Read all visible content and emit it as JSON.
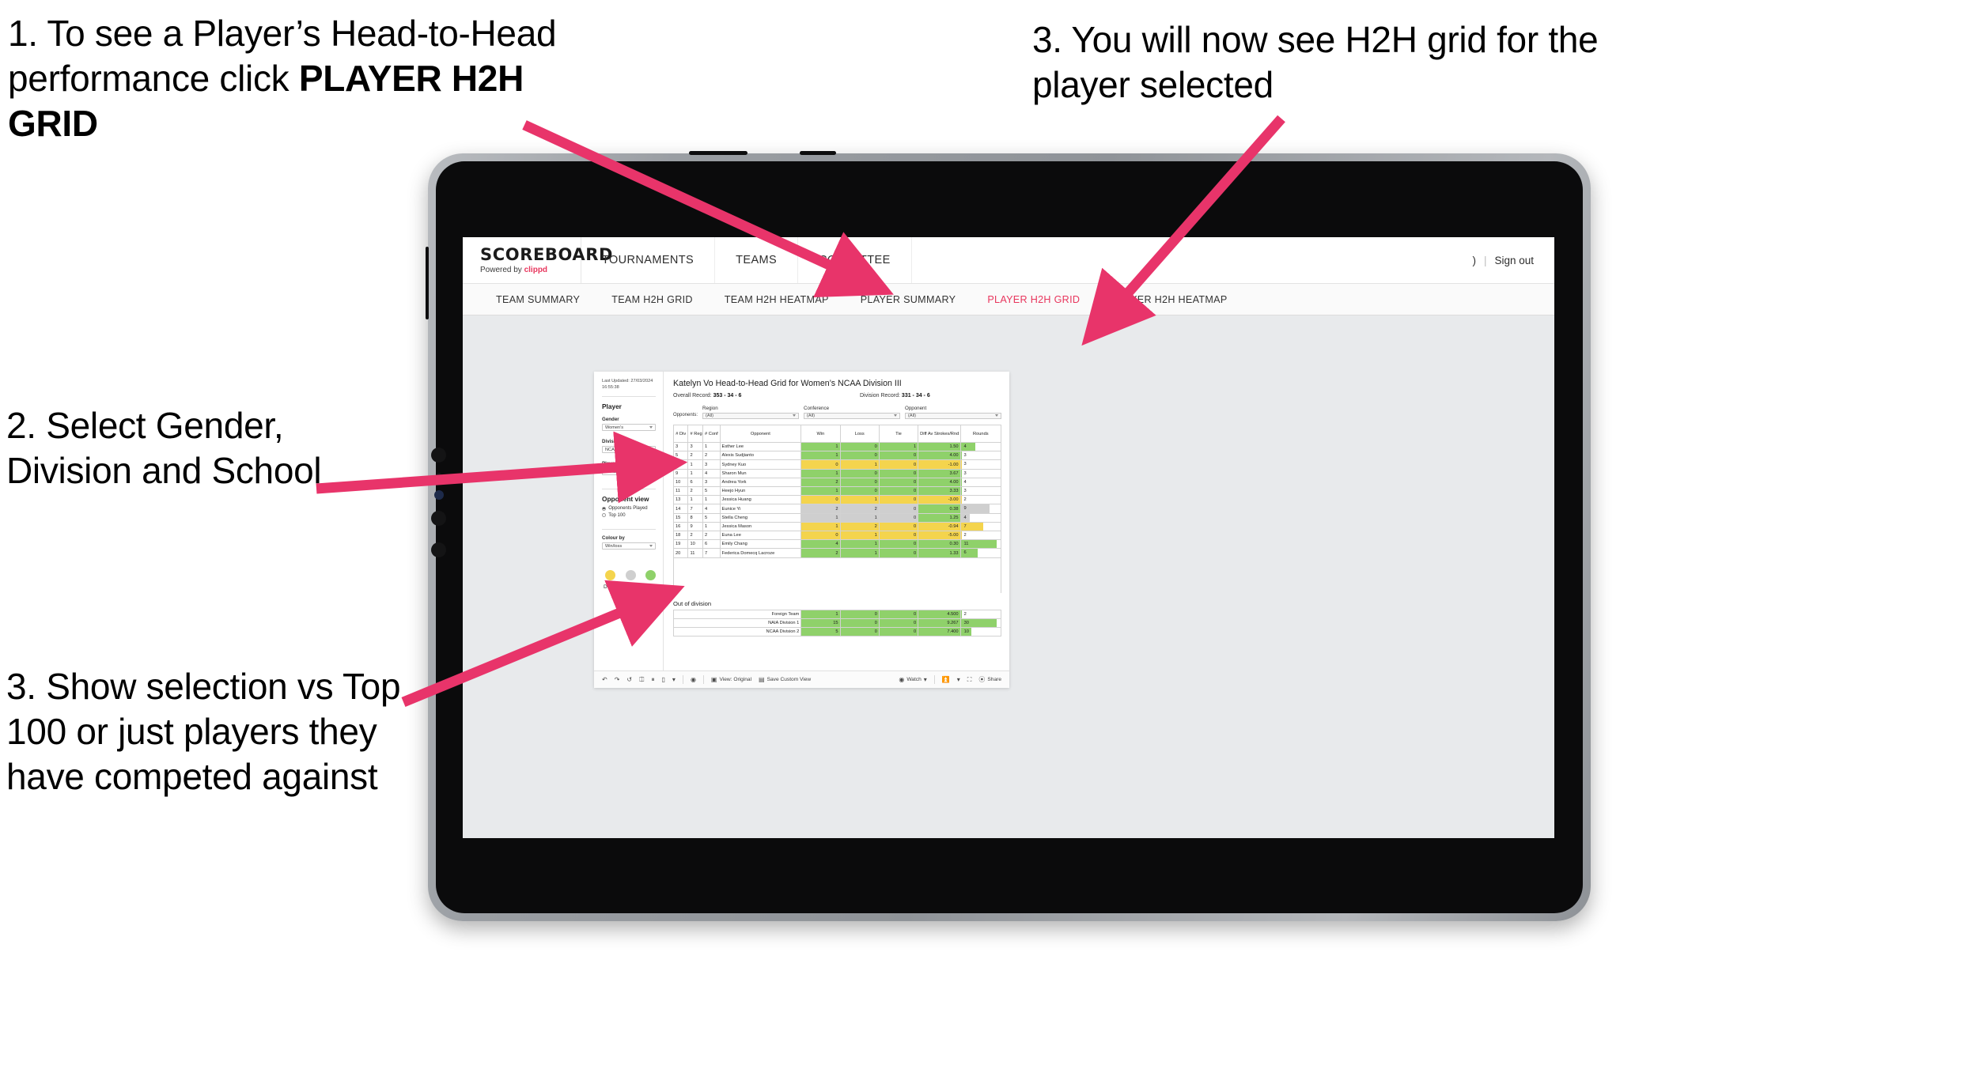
{
  "annotations": [
    {
      "id": "a1",
      "text_plain": "1. To see a Player’s Head-to-Head performance click ",
      "text_bold": "PLAYER H2H GRID"
    },
    {
      "id": "a2",
      "text": "2. Select Gender, Division and School"
    },
    {
      "id": "a3",
      "text": "3. Show selection vs Top 100 or just players they have competed against"
    },
    {
      "id": "a4",
      "text": "3. You will now see H2H grid for the player selected"
    }
  ],
  "colors": {
    "accent_pink": "#e8365d",
    "arrow_pink": "#e8346a",
    "green": "#8fd16a",
    "yellow": "#f4d44d",
    "grey": "#cfcfcf"
  },
  "header": {
    "brand_name": "SCOREBOARD",
    "brand_sub_prefix": "Powered by ",
    "brand_sub_accent": "clippd",
    "nav": [
      {
        "label": "TOURNAMENTS"
      },
      {
        "label": "TEAMS"
      },
      {
        "label": "COMMITTEE"
      }
    ],
    "user_initial": ")",
    "separator": "|",
    "sign_out": "Sign out"
  },
  "subnav": {
    "items": [
      {
        "label": "TEAM SUMMARY",
        "active": false
      },
      {
        "label": "TEAM H2H GRID",
        "active": false
      },
      {
        "label": "TEAM H2H HEATMAP",
        "active": false
      },
      {
        "label": "PLAYER SUMMARY",
        "active": false
      },
      {
        "label": "PLAYER H2H GRID",
        "active": true
      },
      {
        "label": "PLAYER H2H HEATMAP",
        "active": false
      }
    ]
  },
  "sidebar": {
    "last_updated": "Last Updated: 27/03/2024 16:55:38",
    "player_heading": "Player",
    "gender_label": "Gender",
    "gender_value": "Women's",
    "division_label": "Division",
    "division_value": "NCAA Division III",
    "player_rank_label": "Player (Rank)",
    "player_rank_value": "B. Katelyn Vo",
    "opponent_view_heading": "Opponent view",
    "opponent_view_options": [
      {
        "label": "Opponents Played",
        "selected": true
      },
      {
        "label": "Top 100",
        "selected": false
      }
    ],
    "colour_by_label": "Colour by",
    "colour_by_value": "Win/loss",
    "legend": [
      {
        "label": "Down",
        "color": "#f4d44d"
      },
      {
        "label": "Level",
        "color": "#cfcfcf"
      },
      {
        "label": "Up",
        "color": "#8fd16a"
      }
    ]
  },
  "main": {
    "title": "Katelyn Vo Head-to-Head Grid for Women’s NCAA Division III",
    "overall_record_label": "Overall Record:",
    "overall_record_value": "353 -  34 - 6",
    "division_record_label": "Division Record:",
    "division_record_value": "331 -  34 - 6",
    "opponents_label": "Opponents:",
    "filters": [
      {
        "title": "Region",
        "value": "(All)"
      },
      {
        "title": "Conference",
        "value": "(All)"
      },
      {
        "title": "Opponent",
        "value": "(All)"
      }
    ],
    "columns": [
      "# Div",
      "# Reg",
      "# Conf",
      "Opponent",
      "Win",
      "Loss",
      "Tie",
      "Diff Av Strokes/Rnd",
      "Rounds"
    ],
    "rows": [
      {
        "div": "3",
        "reg": "3",
        "conf": "1",
        "opponent": "Esther Lee",
        "win": "1",
        "loss": "0",
        "tie": "1",
        "diff": "1.50",
        "rounds": "4",
        "color": "g",
        "bar_pct": 36
      },
      {
        "div": "5",
        "reg": "2",
        "conf": "2",
        "opponent": "Alexis Sudjianto",
        "win": "1",
        "loss": "0",
        "tie": "0",
        "diff": "4.00",
        "rounds": "3",
        "color": "g",
        "bar_pct": 2
      },
      {
        "div": "6",
        "reg": "1",
        "conf": "3",
        "opponent": "Sydney Kuo",
        "win": "0",
        "loss": "1",
        "tie": "0",
        "diff": "-1.00",
        "rounds": "3",
        "color": "y",
        "bar_pct": 2
      },
      {
        "div": "9",
        "reg": "1",
        "conf": "4",
        "opponent": "Sharon Mun",
        "win": "1",
        "loss": "0",
        "tie": "0",
        "diff": "3.67",
        "rounds": "3",
        "color": "g",
        "bar_pct": 2
      },
      {
        "div": "10",
        "reg": "6",
        "conf": "3",
        "opponent": "Andrea York",
        "win": "2",
        "loss": "0",
        "tie": "0",
        "diff": "4.00",
        "rounds": "4",
        "color": "g",
        "bar_pct": 2
      },
      {
        "div": "11",
        "reg": "2",
        "conf": "5",
        "opponent": "Heejo Hyun",
        "win": "1",
        "loss": "0",
        "tie": "0",
        "diff": "3.33",
        "rounds": "3",
        "color": "g",
        "bar_pct": 2
      },
      {
        "div": "13",
        "reg": "1",
        "conf": "1",
        "opponent": "Jessica Huang",
        "win": "0",
        "loss": "1",
        "tie": "0",
        "diff": "-3.00",
        "rounds": "2",
        "color": "y",
        "bar_pct": 2
      },
      {
        "div": "14",
        "reg": "7",
        "conf": "4",
        "opponent": "Eunice Yi",
        "win": "2",
        "loss": "2",
        "tie": "0",
        "diff": "0.38",
        "rounds": "9",
        "color": "gr",
        "bar_pct": 72,
        "diff_color": "g"
      },
      {
        "div": "15",
        "reg": "8",
        "conf": "5",
        "opponent": "Stella Cheng",
        "win": "1",
        "loss": "1",
        "tie": "0",
        "diff": "1.25",
        "rounds": "4",
        "color": "gr",
        "bar_pct": 22,
        "diff_color": "g"
      },
      {
        "div": "16",
        "reg": "9",
        "conf": "1",
        "opponent": "Jessica Mason",
        "win": "1",
        "loss": "2",
        "tie": "0",
        "diff": "-0.94",
        "rounds": "7",
        "color": "y",
        "bar_pct": 56
      },
      {
        "div": "18",
        "reg": "2",
        "conf": "2",
        "opponent": "Euna Lee",
        "win": "0",
        "loss": "1",
        "tie": "0",
        "diff": "-5.00",
        "rounds": "2",
        "color": "y",
        "bar_pct": 2
      },
      {
        "div": "19",
        "reg": "10",
        "conf": "6",
        "opponent": "Emily Chang",
        "win": "4",
        "loss": "1",
        "tie": "0",
        "diff": "0.30",
        "rounds": "11",
        "color": "g",
        "bar_pct": 90
      },
      {
        "div": "20",
        "reg": "11",
        "conf": "7",
        "opponent": "Federica Domecq Lacroze",
        "win": "2",
        "loss": "1",
        "tie": "0",
        "diff": "1.33",
        "rounds": "6",
        "color": "g",
        "bar_pct": 42
      }
    ],
    "out_of_division_title": "Out of division",
    "out_of_division_rows": [
      {
        "name": "Foreign Team",
        "win": "1",
        "loss": "0",
        "tie": "0",
        "diff": "4.500",
        "rounds": "2",
        "color": "g",
        "bar_pct": 3
      },
      {
        "name": "NAIA Division 1",
        "win": "15",
        "loss": "0",
        "tie": "0",
        "diff": "9.267",
        "rounds": "30",
        "color": "g",
        "bar_pct": 90
      },
      {
        "name": "NCAA Division 2",
        "win": "5",
        "loss": "0",
        "tie": "0",
        "diff": "7.400",
        "rounds": "10",
        "color": "g",
        "bar_pct": 26
      }
    ]
  },
  "toolbar": {
    "undo": "undo-icon",
    "redo": "redo-icon",
    "reset": "reset-icon",
    "refresh": "refresh-data-icon",
    "pause": "pause-updates-icon",
    "view_original_label": "View: Original",
    "save_custom_view_label": "Save Custom View",
    "watch_label": "Watch",
    "download_label": "download-icon",
    "fullscreen_label": "fullscreen-icon",
    "share_label": "Share"
  }
}
